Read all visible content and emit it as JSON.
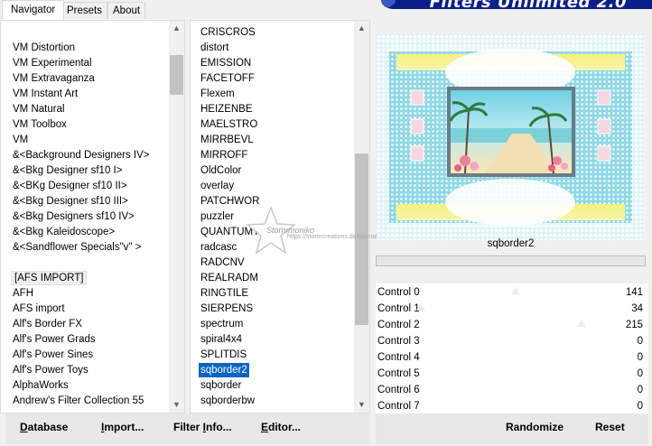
{
  "tabs": [
    {
      "label": "Navigator",
      "active": true
    },
    {
      "label": "Presets",
      "active": false
    },
    {
      "label": "About",
      "active": false
    }
  ],
  "app_title": "Filters Unlimited 2.0",
  "categories": [
    "VM Distortion",
    "VM Experimental",
    "VM Extravaganza",
    "VM Instant Art",
    "VM Natural",
    "VM Toolbox",
    "VM",
    "&<Background Designers IV>",
    "&<Bkg Designer sf10 I>",
    "&<BKg Designer sf10 II>",
    "&<Bkg Designer sf10 III>",
    "&<Bkg Designers sf10 IV>",
    "&<Bkg Kaleidoscope>",
    "&<Sandflower Specials\"v\" >",
    "",
    "[AFS IMPORT]",
    "AFH",
    "AFS import",
    "Alf's Border FX",
    "Alf's Power Grads",
    "Alf's Power Sines",
    "Alf's Power Toys",
    "AlphaWorks",
    "Andrew's Filter Collection 55"
  ],
  "categories_selected": "[AFS IMPORT]",
  "filters": [
    "CRISCROS",
    "distort",
    "EMISSION",
    "FACETOFF",
    "Flexem",
    "HEIZENBE",
    "MAELSTRO",
    "MIRRBEVL",
    "MIRROFF",
    "OldColor",
    "overlay",
    "PATCHWOR",
    "puzzler",
    "QUANTUMT",
    "radcasc",
    "RADCNV",
    "REALRADM",
    "RINGTILE",
    "SIERPENS",
    "spectrum",
    "spiral4x4",
    "SPLITDIS",
    "sqborder2",
    "sqborder",
    "sqborderbw"
  ],
  "filters_selected": "sqborder2",
  "scroll": {
    "left_position": 0.06,
    "mid_position": 0.62
  },
  "filter_name": "sqborder2",
  "controls": [
    {
      "label": "Control 0",
      "value": "141",
      "level": 0.553
    },
    {
      "label": "Control 1",
      "value": "34",
      "level": 0.133
    },
    {
      "label": "Control 2",
      "value": "215",
      "level": 0.843
    },
    {
      "label": "Control 3",
      "value": "0",
      "level": 0
    },
    {
      "label": "Control 4",
      "value": "0",
      "level": 0
    },
    {
      "label": "Control 5",
      "value": "0",
      "level": 0
    },
    {
      "label": "Control 6",
      "value": "0",
      "level": 0
    },
    {
      "label": "Control 7",
      "value": "0",
      "level": 0
    }
  ],
  "buttons": {
    "database": {
      "first": "D",
      "rest": "atabase"
    },
    "import": {
      "first": "I",
      "rest": "mport..."
    },
    "filter_info": {
      "first": "Filter ",
      "ul": "I",
      "rest": "nfo..."
    },
    "editor": {
      "first": "E",
      "rest": "ditor..."
    },
    "randomize": "Randomize",
    "reset": "Reset"
  },
  "watermark": {
    "text": "Stormmoniko",
    "url": "https://stormcreations.de/tutorials/en.de/"
  },
  "colors": {
    "selection": "#0a64c6",
    "title_band": "#0b1f8a"
  },
  "icons": {
    "scroll_up": "▲",
    "scroll_down": "▼"
  }
}
